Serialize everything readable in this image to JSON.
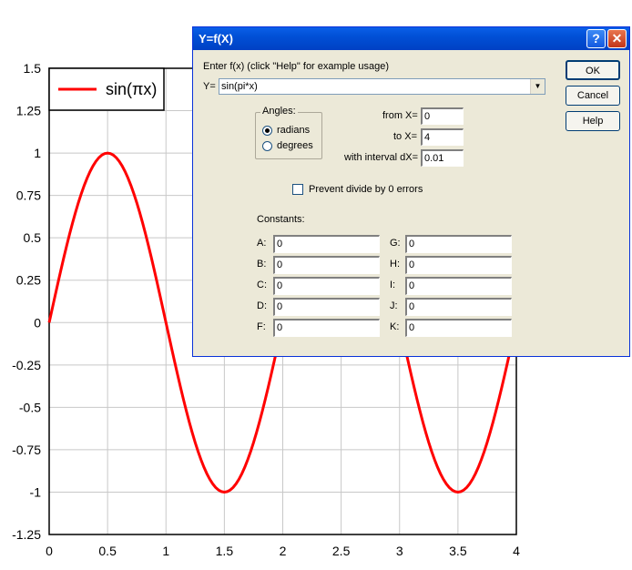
{
  "chart_data": {
    "type": "line",
    "title": "",
    "xlabel": "",
    "ylabel": "",
    "xlim": [
      0,
      4
    ],
    "ylim": [
      -1.25,
      1.5
    ],
    "x_ticks": [
      "0",
      "0.5",
      "1",
      "1.5",
      "2",
      "2.5",
      "3",
      "3.5",
      "4"
    ],
    "y_ticks": [
      "1.5",
      "1.25",
      "1",
      "0.75",
      "0.5",
      "0.25",
      "0",
      "-0.25",
      "-0.5",
      "-0.75",
      "-1",
      "-1.25"
    ],
    "grid": true,
    "legend_position": "top-left",
    "series": [
      {
        "name": "sin(πx)",
        "color": "#ff0000",
        "x": [
          0,
          0.25,
          0.5,
          0.75,
          1,
          1.25,
          1.5,
          1.75,
          2,
          2.25,
          2.5,
          2.75,
          3,
          3.25,
          3.5,
          3.75,
          4
        ],
        "y": [
          0,
          0.707,
          1,
          0.707,
          0,
          -0.707,
          -1,
          -0.707,
          0,
          0.707,
          1,
          0.707,
          0,
          -0.707,
          -1,
          -0.707,
          0
        ]
      }
    ]
  },
  "dialog": {
    "title": "Y=f(X)",
    "help_glyph": "?",
    "close_glyph": "✕",
    "enter_label": "Enter f(x) (click \"Help\" for example usage)",
    "y_label": "Y=",
    "expression": "sin(pi*x)",
    "dropdown_glyph": "▼",
    "ok_label": "OK",
    "cancel_label": "Cancel",
    "help_label": "Help",
    "angles_label": "Angles:",
    "radians_label": "radians",
    "degrees_label": "degrees",
    "angle_selected": "radians",
    "from_label": "from X=",
    "from_value": "0",
    "to_label": "to X=",
    "to_value": "4",
    "interval_label": "with interval dX=",
    "interval_value": "0.01",
    "prevent_label": "Prevent divide by 0 errors",
    "prevent_checked": false,
    "constants_label": "Constants:",
    "constants_left": [
      {
        "label": "A:",
        "value": "0"
      },
      {
        "label": "B:",
        "value": "0"
      },
      {
        "label": "C:",
        "value": "0"
      },
      {
        "label": "D:",
        "value": "0"
      },
      {
        "label": "F:",
        "value": "0"
      }
    ],
    "constants_right": [
      {
        "label": "G:",
        "value": "0"
      },
      {
        "label": "H:",
        "value": "0"
      },
      {
        "label": "I:",
        "value": "0"
      },
      {
        "label": "J:",
        "value": "0"
      },
      {
        "label": "K:",
        "value": "0"
      }
    ]
  }
}
